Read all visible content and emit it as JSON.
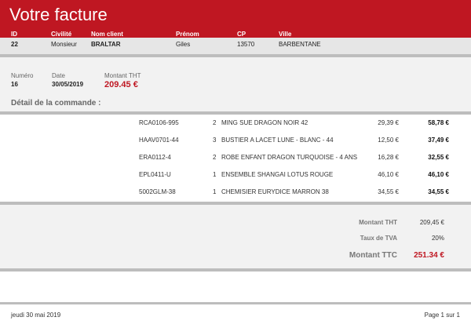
{
  "invoice": {
    "title": "Votre facture",
    "client_headers": {
      "id": "ID",
      "civilite": "Civilité",
      "nom": "Nom client",
      "prenom": "Prénom",
      "cp": "CP",
      "ville": "Ville"
    },
    "client": {
      "id": "22",
      "civilite": "Monsieur",
      "nom": "BRALTAR",
      "prenom": "Giles",
      "cp": "13570",
      "ville": "BARBENTANE"
    },
    "meta_labels": {
      "numero": "Numéro",
      "date": "Date",
      "montant": "Montant THT"
    },
    "meta": {
      "numero": "16",
      "date": "30/05/2019",
      "montant": "209.45 €"
    },
    "detail_title": "Détail de la commande :",
    "lines": [
      {
        "ref": "RCA0106-995",
        "qty": "2",
        "designation": "MING SUE DRAGON NOIR 42",
        "unit_price": "29,39 €",
        "total": "58,78 €"
      },
      {
        "ref": "HAAV0701-44",
        "qty": "3",
        "designation": "BUSTIER A LACET LUNE - BLANC - 44",
        "unit_price": "12,50 €",
        "total": "37,49 €"
      },
      {
        "ref": "ERA0112-4",
        "qty": "2",
        "designation": "ROBE ENFANT DRAGON TURQUOISE - 4 ANS",
        "unit_price": "16,28 €",
        "total": "32,55 €"
      },
      {
        "ref": "EPL0411-U",
        "qty": "1",
        "designation": "ENSEMBLE SHANGAI LOTUS ROUGE",
        "unit_price": "46,10 €",
        "total": "46,10 €"
      },
      {
        "ref": "5002GLM-38",
        "qty": "1",
        "designation": "CHEMISIER EURYDICE MARRON 38",
        "unit_price": "34,55 €",
        "total": "34,55 €"
      }
    ],
    "summary": {
      "montant_tht_label": "Montant THT",
      "montant_tht": "209,45 €",
      "tva_label": "Taux de TVA",
      "tva": "20%",
      "montant_ttc_label": "Montant TTC",
      "montant_ttc": "251.34 €"
    },
    "footer": {
      "date": "jeudi 30 mai 2019",
      "page": "Page 1 sur 1"
    }
  },
  "colors": {
    "brand_red": "#bf1722",
    "band_gray": "#f2f2f2",
    "accent_total": "#bf1722"
  }
}
